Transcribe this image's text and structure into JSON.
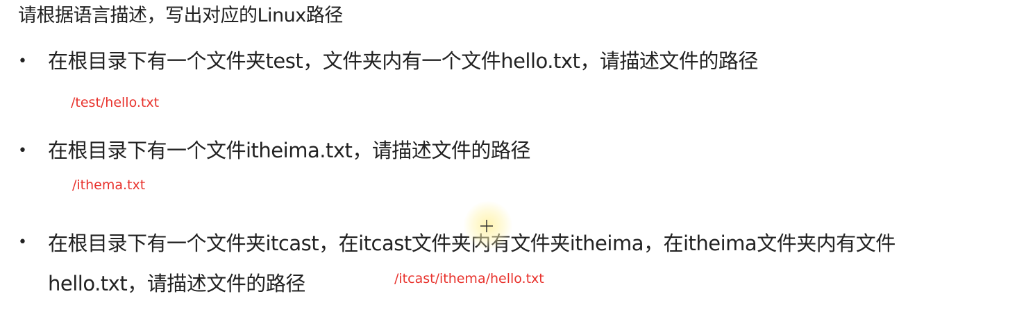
{
  "title": "请根据语言描述，写出对应的Linux路径",
  "items": [
    {
      "bullet": "•",
      "question": "在根目录下有一个文件夹test，文件夹内有一个文件hello.txt，请描述文件的路径",
      "answer": "/test/hello.txt"
    },
    {
      "bullet": "•",
      "question": "在根目录下有一个文件itheima.txt，请描述文件的路径",
      "answer": "/ithema.txt"
    },
    {
      "bullet": "•",
      "question_line1": "在根目录下有一个文件夹itcast，在itcast文件夹内有文件夹itheima，在itheima文件夹内有文件",
      "question_line2": "hello.txt，请描述文件的路径",
      "answer": "/itcast/ithema/hello.txt"
    }
  ],
  "colors": {
    "text": "#222222",
    "answer": "#e8322c",
    "cursor_highlight": "#fff09a"
  },
  "icons": {
    "cursor": "crosshair-cursor-icon"
  }
}
